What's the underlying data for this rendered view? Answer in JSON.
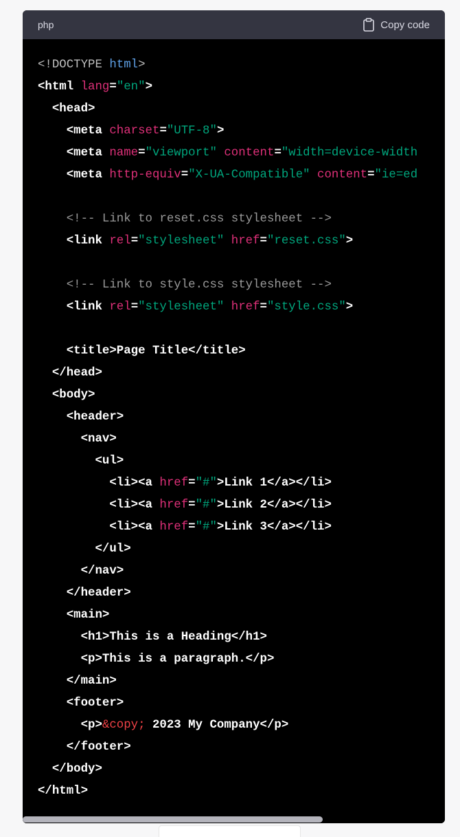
{
  "code_block": {
    "language": "php",
    "copy_label": "Copy code",
    "copy_icon": "clipboard-icon",
    "colors": {
      "header_bg": "#343541",
      "body_bg": "#000000",
      "attr": "#df3079",
      "string": "#00a67d",
      "comment": "#9a9a9a",
      "doctype_keyword": "#5ea0e6",
      "entity": "#ef4146"
    },
    "lines": [
      [
        {
          "t": "doctype",
          "v": "<!DOCTYPE "
        },
        {
          "t": "doctype-kw",
          "v": "html"
        },
        {
          "t": "doctype",
          "v": ">"
        }
      ],
      [
        {
          "t": "tag",
          "v": "<html "
        },
        {
          "t": "attr",
          "v": "lang"
        },
        {
          "t": "tag",
          "v": "="
        },
        {
          "t": "str",
          "v": "\"en\""
        },
        {
          "t": "tag",
          "v": ">"
        }
      ],
      [
        {
          "t": "tag",
          "v": "  <head>"
        }
      ],
      [
        {
          "t": "tag",
          "v": "    <meta "
        },
        {
          "t": "attr",
          "v": "charset"
        },
        {
          "t": "tag",
          "v": "="
        },
        {
          "t": "str",
          "v": "\"UTF-8\""
        },
        {
          "t": "tag",
          "v": ">"
        }
      ],
      [
        {
          "t": "tag",
          "v": "    <meta "
        },
        {
          "t": "attr",
          "v": "name"
        },
        {
          "t": "tag",
          "v": "="
        },
        {
          "t": "str",
          "v": "\"viewport\""
        },
        {
          "t": "tag",
          "v": " "
        },
        {
          "t": "attr",
          "v": "content"
        },
        {
          "t": "tag",
          "v": "="
        },
        {
          "t": "str",
          "v": "\"width=device-width"
        }
      ],
      [
        {
          "t": "tag",
          "v": "    <meta "
        },
        {
          "t": "attr",
          "v": "http-equiv"
        },
        {
          "t": "tag",
          "v": "="
        },
        {
          "t": "str",
          "v": "\"X-UA-Compatible\""
        },
        {
          "t": "tag",
          "v": " "
        },
        {
          "t": "attr",
          "v": "content"
        },
        {
          "t": "tag",
          "v": "="
        },
        {
          "t": "str",
          "v": "\"ie=ed"
        }
      ],
      [],
      [
        {
          "t": "comment",
          "v": "    <!-- Link to reset.css stylesheet -->"
        }
      ],
      [
        {
          "t": "tag",
          "v": "    <link "
        },
        {
          "t": "attr",
          "v": "rel"
        },
        {
          "t": "tag",
          "v": "="
        },
        {
          "t": "str",
          "v": "\"stylesheet\""
        },
        {
          "t": "tag",
          "v": " "
        },
        {
          "t": "attr",
          "v": "href"
        },
        {
          "t": "tag",
          "v": "="
        },
        {
          "t": "str",
          "v": "\"reset.css\""
        },
        {
          "t": "tag",
          "v": ">"
        }
      ],
      [],
      [
        {
          "t": "comment",
          "v": "    <!-- Link to style.css stylesheet -->"
        }
      ],
      [
        {
          "t": "tag",
          "v": "    <link "
        },
        {
          "t": "attr",
          "v": "rel"
        },
        {
          "t": "tag",
          "v": "="
        },
        {
          "t": "str",
          "v": "\"stylesheet\""
        },
        {
          "t": "tag",
          "v": " "
        },
        {
          "t": "attr",
          "v": "href"
        },
        {
          "t": "tag",
          "v": "="
        },
        {
          "t": "str",
          "v": "\"style.css\""
        },
        {
          "t": "tag",
          "v": ">"
        }
      ],
      [],
      [
        {
          "t": "tag",
          "v": "    <title>Page Title</title>"
        }
      ],
      [
        {
          "t": "tag",
          "v": "  </head>"
        }
      ],
      [
        {
          "t": "tag",
          "v": "  <body>"
        }
      ],
      [
        {
          "t": "tag",
          "v": "    <header>"
        }
      ],
      [
        {
          "t": "tag",
          "v": "      <nav>"
        }
      ],
      [
        {
          "t": "tag",
          "v": "        <ul>"
        }
      ],
      [
        {
          "t": "tag",
          "v": "          <li><a "
        },
        {
          "t": "attr",
          "v": "href"
        },
        {
          "t": "tag",
          "v": "="
        },
        {
          "t": "str",
          "v": "\"#\""
        },
        {
          "t": "tag",
          "v": ">Link 1</a></li>"
        }
      ],
      [
        {
          "t": "tag",
          "v": "          <li><a "
        },
        {
          "t": "attr",
          "v": "href"
        },
        {
          "t": "tag",
          "v": "="
        },
        {
          "t": "str",
          "v": "\"#\""
        },
        {
          "t": "tag",
          "v": ">Link 2</a></li>"
        }
      ],
      [
        {
          "t": "tag",
          "v": "          <li><a "
        },
        {
          "t": "attr",
          "v": "href"
        },
        {
          "t": "tag",
          "v": "="
        },
        {
          "t": "str",
          "v": "\"#\""
        },
        {
          "t": "tag",
          "v": ">Link 3</a></li>"
        }
      ],
      [
        {
          "t": "tag",
          "v": "        </ul>"
        }
      ],
      [
        {
          "t": "tag",
          "v": "      </nav>"
        }
      ],
      [
        {
          "t": "tag",
          "v": "    </header>"
        }
      ],
      [
        {
          "t": "tag",
          "v": "    <main>"
        }
      ],
      [
        {
          "t": "tag",
          "v": "      <h1>This is a Heading</h1>"
        }
      ],
      [
        {
          "t": "tag",
          "v": "      <p>This is a paragraph.</p>"
        }
      ],
      [
        {
          "t": "tag",
          "v": "    </main>"
        }
      ],
      [
        {
          "t": "tag",
          "v": "    <footer>"
        }
      ],
      [
        {
          "t": "tag",
          "v": "      <p>"
        },
        {
          "t": "entity",
          "v": "&copy;"
        },
        {
          "t": "tag",
          "v": " 2023 My Company</p>"
        }
      ],
      [
        {
          "t": "tag",
          "v": "    </footer>"
        }
      ],
      [
        {
          "t": "tag",
          "v": "  </body>"
        }
      ],
      [
        {
          "t": "tag",
          "v": "</html>"
        }
      ]
    ],
    "horizontal_scroll_fraction": 0.71
  }
}
